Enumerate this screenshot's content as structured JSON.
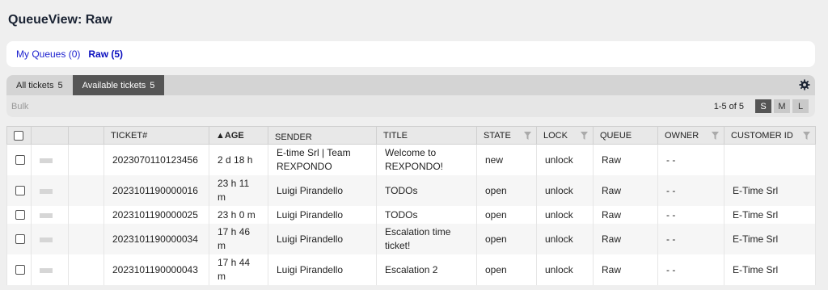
{
  "page": {
    "title": "QueueView: Raw"
  },
  "queues": {
    "my_queues": "My Queues (0)",
    "raw": "Raw (5)"
  },
  "filters": {
    "all_label": "All tickets",
    "all_count": "5",
    "available_label": "Available tickets",
    "available_count": "5"
  },
  "actions": {
    "bulk": "Bulk",
    "paging": "1-5 of 5",
    "sizes": [
      "S",
      "M",
      "L"
    ]
  },
  "columns": {
    "ticket": "TICKET#",
    "age": "▲AGE",
    "sender": "SENDER",
    "title": "TITLE",
    "state": "STATE",
    "lock": "LOCK",
    "queue": "QUEUE",
    "owner": "OWNER",
    "customer": "CUSTOMER ID"
  },
  "rows": [
    {
      "ticket": "2023070110123456",
      "age": "2 d 18 h",
      "sender": "E-time Srl | Team REXPONDO",
      "title": "Welcome to REXPONDO!",
      "state": "new",
      "lock": "unlock",
      "queue": "Raw",
      "owner": "- -",
      "customer": ""
    },
    {
      "ticket": "2023101190000016",
      "age": "23 h 11 m",
      "sender": "Luigi Pirandello",
      "title": "TODOs",
      "state": "open",
      "lock": "unlock",
      "queue": "Raw",
      "owner": "- -",
      "customer": "E-Time Srl"
    },
    {
      "ticket": "2023101190000025",
      "age": "23 h 0 m",
      "sender": "Luigi Pirandello",
      "title": "TODOs",
      "state": "open",
      "lock": "unlock",
      "queue": "Raw",
      "owner": "- -",
      "customer": "E-Time Srl"
    },
    {
      "ticket": "2023101190000034",
      "age": "17 h 46 m",
      "sender": "Luigi Pirandello",
      "title": "Escalation time ticket!",
      "state": "open",
      "lock": "unlock",
      "queue": "Raw",
      "owner": "- -",
      "customer": "E-Time Srl"
    },
    {
      "ticket": "2023101190000043",
      "age": "17 h 44 m",
      "sender": "Luigi Pirandello",
      "title": "Escalation 2",
      "state": "open",
      "lock": "unlock",
      "queue": "Raw",
      "owner": "- -",
      "customer": "E-Time Srl"
    }
  ]
}
